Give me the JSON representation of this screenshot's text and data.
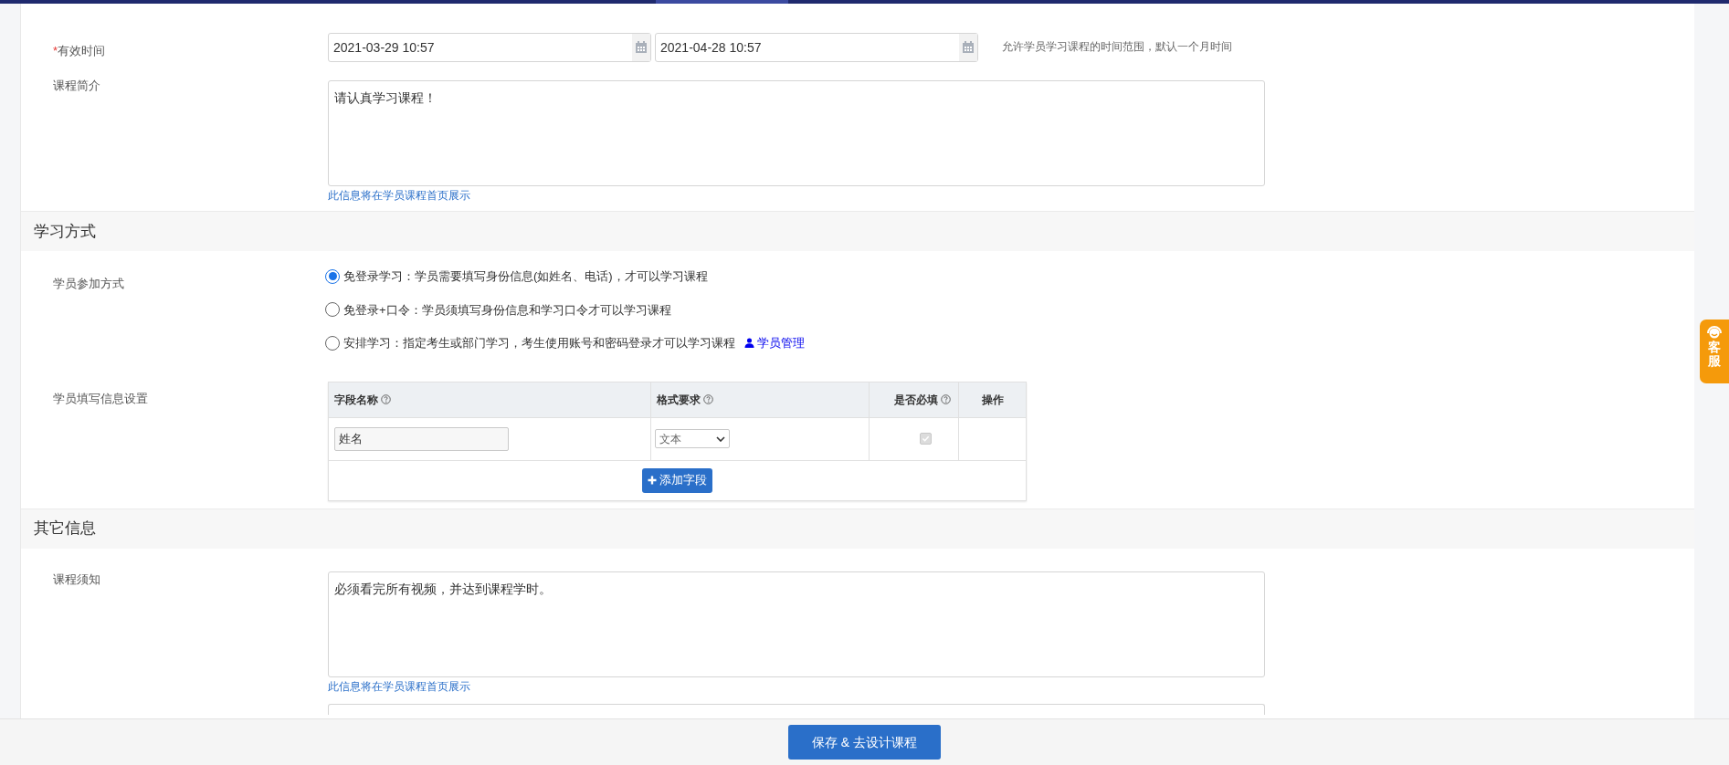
{
  "validity": {
    "label": "有效时间",
    "required_mark": "*",
    "start": "2021-03-29 10:57",
    "end": "2021-04-28 10:57",
    "hint": "允许学员学习课程的时间范围，默认一个月时间"
  },
  "intro": {
    "label": "课程简介",
    "value": "请认真学习课程！",
    "hint": "此信息将在学员课程首页展示"
  },
  "study_section": {
    "title": "学习方式",
    "join": {
      "label": "学员参加方式",
      "options": [
        {
          "label": "免登录学习：学员需要填写身份信息(如姓名、电话)，才可以学习课程",
          "selected": true
        },
        {
          "label": "免登录+口令：学员须填写身份信息和学习口令才可以学习课程",
          "selected": false
        },
        {
          "label": "安排学习：指定考生或部门学习，考生使用账号和密码登录才可以学习课程",
          "selected": false,
          "link": "学员管理"
        }
      ]
    },
    "fields": {
      "label": "学员填写信息设置",
      "columns": [
        {
          "label": "字段名称",
          "help": true
        },
        {
          "label": "格式要求",
          "help": true
        },
        {
          "label": "是否必填",
          "help": true
        },
        {
          "label": "操作",
          "help": false
        }
      ],
      "rows": [
        {
          "name": "姓名",
          "format": "文本",
          "required": true,
          "disabled": true
        }
      ],
      "add_button": "添加字段"
    }
  },
  "other_section": {
    "title": "其它信息",
    "notice": {
      "label": "课程须知",
      "value": "必须看完所有视频，并达到课程学时。",
      "hint": "此信息将在学员课程首页展示"
    }
  },
  "service_badge": {
    "label": "客服"
  },
  "footer": {
    "button": "保存 & 去设计课程"
  }
}
